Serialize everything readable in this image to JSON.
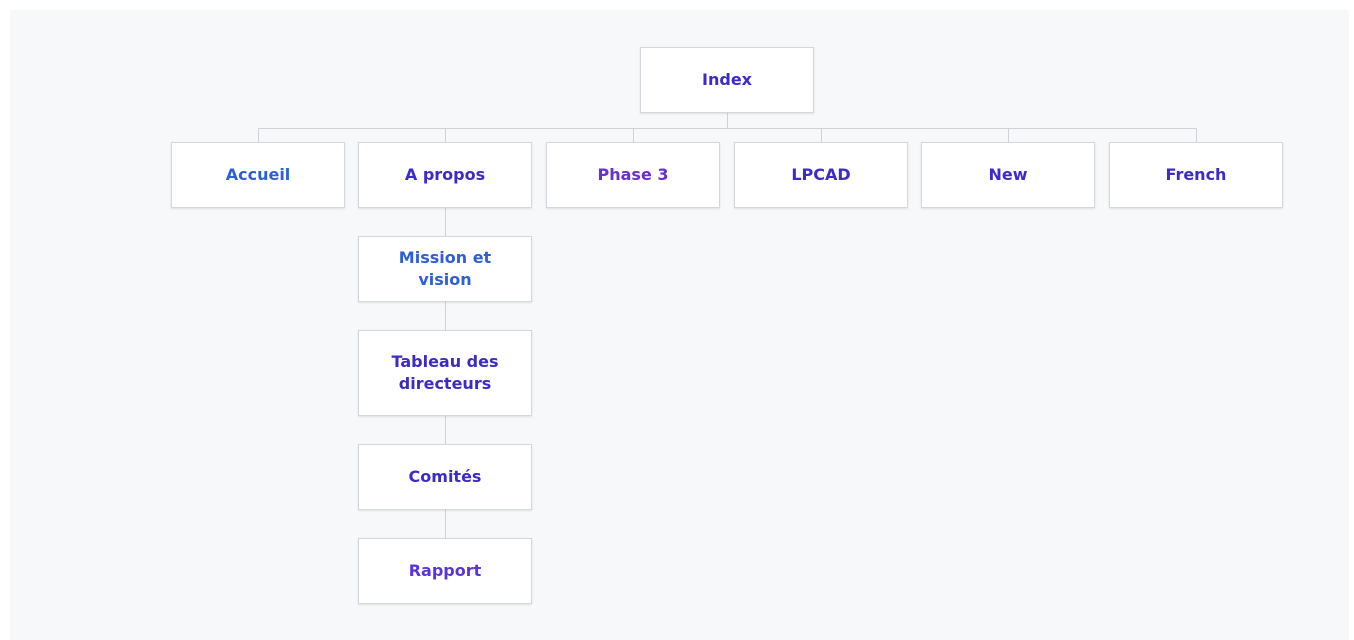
{
  "colors": {
    "line": "#cfd2d8",
    "background": "#f7f8fa"
  },
  "sitemap": {
    "root": {
      "id": "index",
      "label": "Index",
      "color": "#3b2bc9"
    },
    "pages": [
      {
        "id": "accueil",
        "label": "Accueil",
        "color": "#2f5fd6"
      },
      {
        "id": "a-propos",
        "label": "A propos",
        "color": "#3b2bc9",
        "children": [
          {
            "id": "mission-et-vision",
            "label": "Mission et vision",
            "color": "#2f5fd6"
          },
          {
            "id": "tableau-des-directeurs",
            "label": "Tableau des directeurs",
            "color": "#3b2bc9"
          },
          {
            "id": "comites",
            "label": "Comités",
            "color": "#3b2bc9"
          },
          {
            "id": "rapport",
            "label": "Rapport",
            "color": "#5b34d9"
          }
        ]
      },
      {
        "id": "phase-3",
        "label": "Phase 3",
        "color": "#6a2fd1"
      },
      {
        "id": "lpcad",
        "label": "LPCAD",
        "color": "#3b2bc9"
      },
      {
        "id": "new",
        "label": "New",
        "color": "#3b2bc9"
      },
      {
        "id": "french",
        "label": "French",
        "color": "#3b2bc9"
      }
    ]
  }
}
